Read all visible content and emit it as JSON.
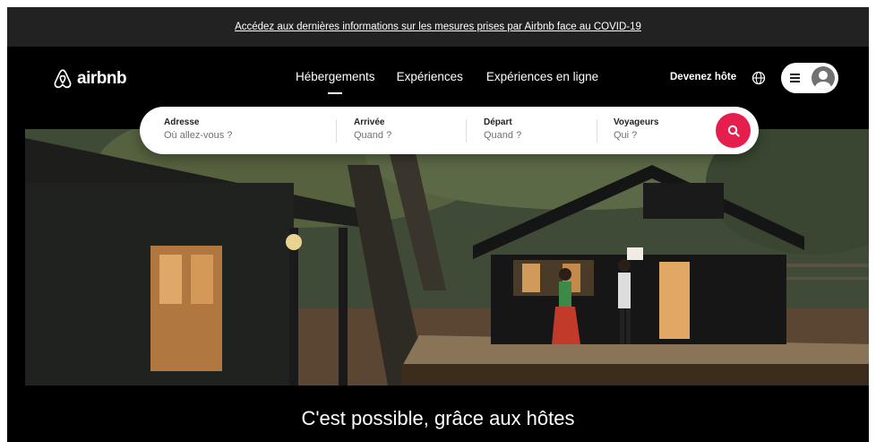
{
  "banner": {
    "text": "Accédez aux dernières informations sur les mesures prises par Airbnb face au COVID-19"
  },
  "header": {
    "logo_text": "airbnb",
    "nav": [
      {
        "label": "Hébergements",
        "active": true
      },
      {
        "label": "Expériences",
        "active": false
      },
      {
        "label": "Expériences en ligne",
        "active": false
      }
    ],
    "host_link": "Devenez hôte",
    "icons": [
      "airbnb-logo-icon",
      "globe-icon",
      "menu-icon",
      "user-avatar-icon"
    ]
  },
  "search": {
    "fields": [
      {
        "label": "Adresse",
        "placeholder": "Où allez-vous ?"
      },
      {
        "label": "Arrivée",
        "placeholder": "Quand ?"
      },
      {
        "label": "Départ",
        "placeholder": "Quand ?"
      },
      {
        "label": "Voyageurs",
        "placeholder": "Qui ?"
      }
    ],
    "button_icon": "search-icon"
  },
  "hero": {
    "tagline": "C'est possible, grâce aux hôtes"
  },
  "colors": {
    "brand": "#e61e4d",
    "background": "#000000",
    "banner": "#222222",
    "text": "#ffffff"
  }
}
